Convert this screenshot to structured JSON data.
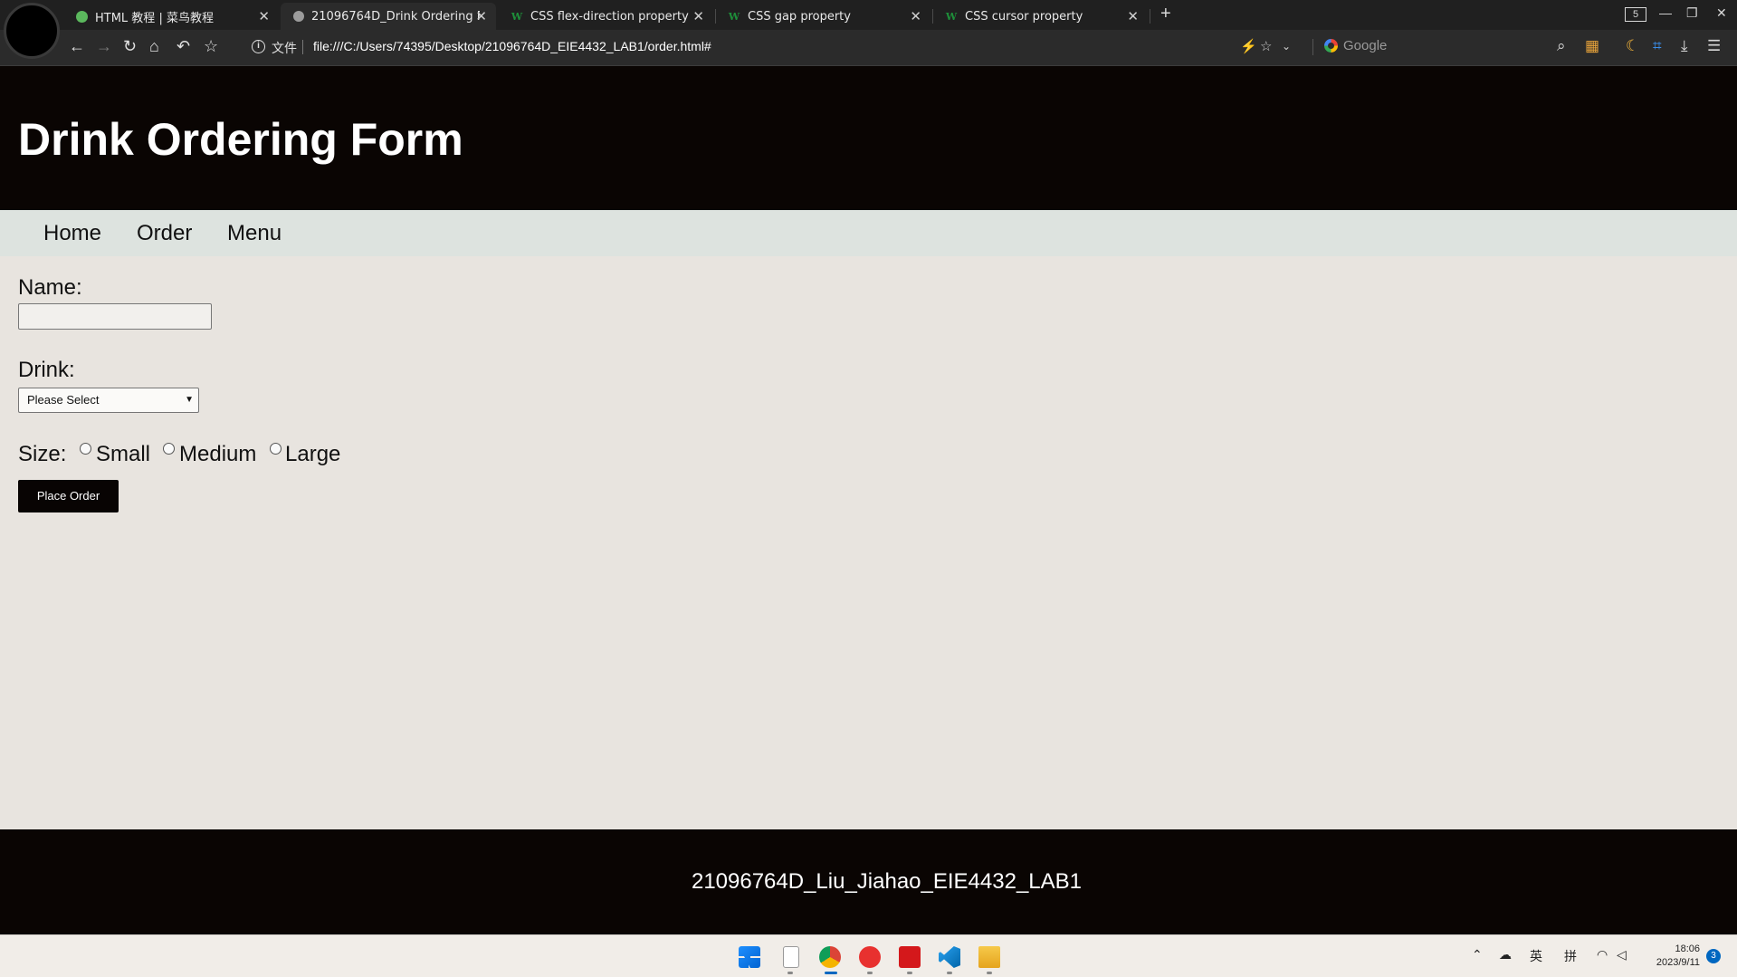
{
  "browser": {
    "tabs": [
      {
        "label": "HTML 教程 | 菜鸟教程",
        "favicon": "runoob-icon",
        "active": false
      },
      {
        "label": "21096764D_Drink Ordering Fo",
        "favicon": "page-icon",
        "active": true
      },
      {
        "label": "CSS flex-direction property",
        "favicon": "w3schools-icon",
        "active": false
      },
      {
        "label": "CSS gap property",
        "favicon": "w3schools-icon",
        "active": false
      },
      {
        "label": "CSS cursor property",
        "favicon": "w3schools-icon",
        "active": false
      }
    ],
    "tab_count": "5",
    "protocol_label": "文件",
    "url": "file:///C:/Users/74395/Desktop/21096764D_EIE4432_LAB1/order.html#",
    "search_engine": "Google"
  },
  "page": {
    "title": "Drink Ordering Form",
    "nav": [
      "Home",
      "Order",
      "Menu"
    ],
    "form": {
      "name_label": "Name:",
      "name_value": "",
      "drink_label": "Drink:",
      "drink_selected": "Please Select",
      "size_label": "Size:",
      "size_options": [
        "Small",
        "Medium",
        "Large"
      ],
      "submit_label": "Place Order"
    },
    "footer": "21096764D_Liu_Jiahao_EIE4432_LAB1"
  },
  "taskbar": {
    "ime_lang": "英",
    "ime_mode": "拼",
    "time": "18:06",
    "date": "2023/9/11",
    "notifications": "3"
  },
  "colors": {
    "header_bg": "#0a0503",
    "nav_bg": "#dde3df",
    "page_bg": "#e8e4df",
    "button_bg": "#080403"
  }
}
